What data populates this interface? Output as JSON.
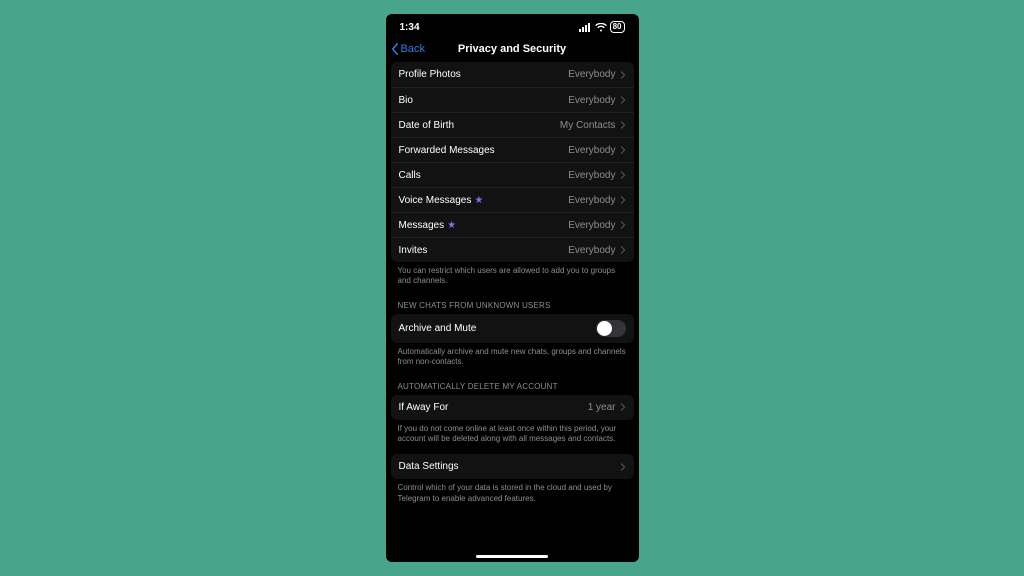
{
  "statusbar": {
    "time": "1:34",
    "battery": "80"
  },
  "nav": {
    "back": "Back",
    "title": "Privacy and Security"
  },
  "privacy_rows": [
    {
      "label": "Profile Photos",
      "value": "Everybody",
      "premium": false
    },
    {
      "label": "Bio",
      "value": "Everybody",
      "premium": false
    },
    {
      "label": "Date of Birth",
      "value": "My Contacts",
      "premium": false
    },
    {
      "label": "Forwarded Messages",
      "value": "Everybody",
      "premium": false
    },
    {
      "label": "Calls",
      "value": "Everybody",
      "premium": false
    },
    {
      "label": "Voice Messages",
      "value": "Everybody",
      "premium": true
    },
    {
      "label": "Messages",
      "value": "Everybody",
      "premium": true
    },
    {
      "label": "Invites",
      "value": "Everybody",
      "premium": false
    }
  ],
  "privacy_footer": "You can restrict which users are allowed to add you to groups and channels.",
  "new_chats": {
    "header": "NEW CHATS FROM UNKNOWN USERS",
    "row_label": "Archive and Mute",
    "toggle_on": false,
    "footer": "Automatically archive and mute new chats, groups and channels from non-contacts."
  },
  "auto_delete": {
    "header": "AUTOMATICALLY DELETE MY ACCOUNT",
    "row_label": "If Away For",
    "row_value": "1 year",
    "footer": "If you do not come online at least once within this period, your account will be deleted along with all messages and contacts."
  },
  "data_settings": {
    "row_label": "Data Settings",
    "footer": "Control which of your data is stored in the cloud and used by Telegram to enable advanced features."
  }
}
